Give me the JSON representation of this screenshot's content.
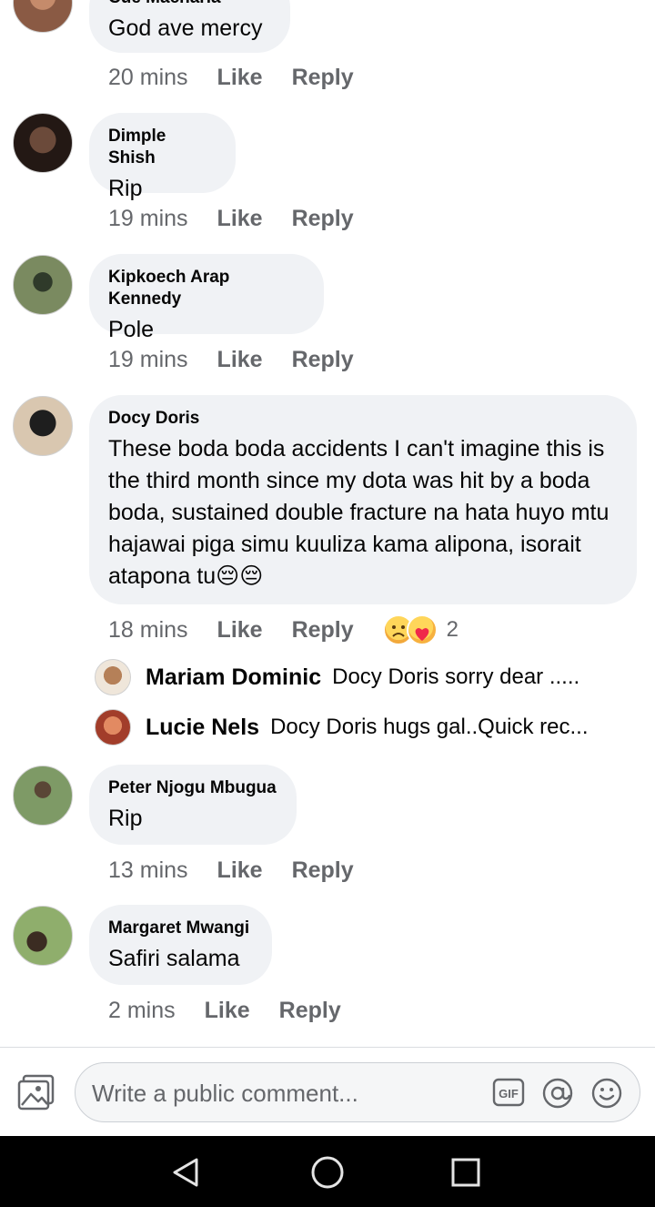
{
  "comments": [
    {
      "author": "Cue Macharia",
      "text": "God ave mercy",
      "time": "20 mins",
      "like_label": "Like",
      "reply_label": "Reply",
      "avatar_color": "#8a5a44"
    },
    {
      "author": "Dimple Shish",
      "text": "Rip",
      "time": "19 mins",
      "like_label": "Like",
      "reply_label": "Reply",
      "avatar_color": "#3a2a22"
    },
    {
      "author": "Kipkoech Arap Kennedy",
      "text": "Pole",
      "time": "19 mins",
      "like_label": "Like",
      "reply_label": "Reply",
      "avatar_color": "#5d6b48"
    },
    {
      "author": "Docy Doris",
      "text": "These boda boda accidents I can't imagine this is the third month since my dota was hit by a boda boda, sustained double fracture na hata huyo mtu hajawai piga simu kuuliza kama alipona, isorait atapona tu😔😔",
      "time": "18 mins",
      "like_label": "Like",
      "reply_label": "Reply",
      "reaction_count": "2",
      "reaction_icons": [
        "sad-face-icon",
        "care-hug-icon"
      ],
      "avatar_color": "#2b2b2b",
      "replies": [
        {
          "author": "Mariam Dominic",
          "text": "Docy Doris sorry dear .....",
          "avatar_color": "#c49a6c"
        },
        {
          "author": "Lucie Nels",
          "text": "Docy Doris hugs gal..Quick rec...",
          "avatar_color": "#c0573c"
        }
      ]
    },
    {
      "author": "Peter Njogu Mbugua",
      "text": "Rip",
      "time": "13 mins",
      "like_label": "Like",
      "reply_label": "Reply",
      "avatar_color": "#6f8a5a"
    },
    {
      "author": "Margaret Mwangi",
      "text": "Safiri salama",
      "time": "2 mins",
      "like_label": "Like",
      "reply_label": "Reply",
      "avatar_color": "#7c9a58"
    }
  ],
  "composer": {
    "placeholder": "Write a public comment...",
    "icons": [
      "photo-icon",
      "gif-icon",
      "mention-icon",
      "emoji-icon"
    ]
  },
  "system_nav": {
    "icons": [
      "back-icon",
      "home-icon",
      "recents-icon"
    ]
  },
  "colors": {
    "bubble": "#f0f2f5",
    "meta_text": "#65676b",
    "primary_text": "#050505",
    "nav_bar": "#000000"
  }
}
